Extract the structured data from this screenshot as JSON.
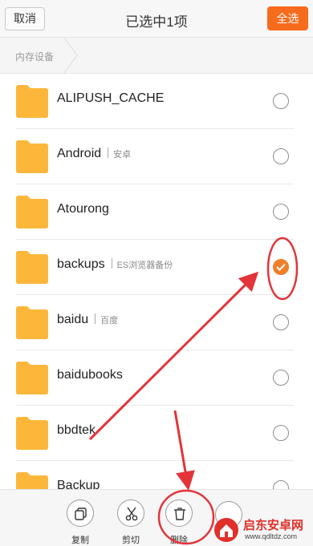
{
  "header": {
    "cancel_label": "取消",
    "title": "已选中1项",
    "select_all_label": "全选"
  },
  "breadcrumb": {
    "label": "内存设备"
  },
  "files": [
    {
      "name": "ALIPUSH_CACHE",
      "sub": "",
      "selected": false
    },
    {
      "name": "Android",
      "sub": "安卓",
      "selected": false
    },
    {
      "name": "Atourong",
      "sub": "",
      "selected": false
    },
    {
      "name": "backups",
      "sub": "ES浏览器备份",
      "selected": true
    },
    {
      "name": "baidu",
      "sub": "百度",
      "selected": false
    },
    {
      "name": "baidubooks",
      "sub": "",
      "selected": false
    },
    {
      "name": "bbdtek",
      "sub": "",
      "selected": false
    },
    {
      "name": "Backup",
      "sub": "",
      "selected": false
    }
  ],
  "toolbar": {
    "copy_label": "复制",
    "cut_label": "剪切",
    "delete_label": "删除"
  },
  "watermark": {
    "text": "启东安卓网",
    "url": "www.qdltdz.com"
  },
  "colors": {
    "accent": "#f66b1c",
    "folder": "#fcb73a",
    "annotation": "#e3343a"
  }
}
